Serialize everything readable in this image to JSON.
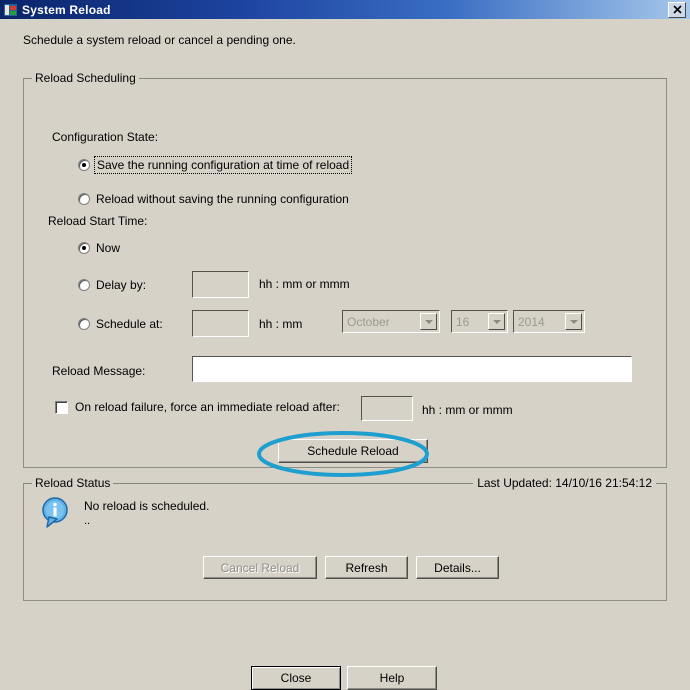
{
  "window": {
    "title": "System Reload",
    "icon": "app-icon",
    "close_label": "✕"
  },
  "intro": "Schedule a system reload or cancel a pending one.",
  "scheduling": {
    "legend": "Reload Scheduling",
    "config_state_label": "Configuration State:",
    "config_options": [
      {
        "label": "Save the running configuration at time of reload",
        "selected": true,
        "focused": true
      },
      {
        "label": "Reload without saving the running configuration",
        "selected": false,
        "focused": false
      }
    ],
    "start_time_label": "Reload Start Time:",
    "start_options": [
      {
        "label": "Now",
        "selected": true
      },
      {
        "label": "Delay by:",
        "selected": false
      },
      {
        "label": "Schedule at:",
        "selected": false
      }
    ],
    "delay_value": "",
    "delay_hint": "hh : mm or mmm",
    "schedule_time_value": "",
    "schedule_time_hint": "hh : mm",
    "month_value": "October",
    "day_value": "16",
    "year_value": "2014",
    "message_label": "Reload Message:",
    "message_value": "",
    "force_reload_label": "On reload failure, force an immediate reload after:",
    "force_reload_checked": false,
    "force_reload_value": "",
    "force_reload_hint": "hh : mm or mmm",
    "schedule_button": "Schedule Reload"
  },
  "status": {
    "legend": "Reload Status",
    "icon": "info-icon",
    "message": "No reload is scheduled.",
    "message_second_line": "..",
    "buttons": [
      {
        "label": "Cancel Reload",
        "disabled": true
      },
      {
        "label": "Refresh",
        "disabled": false
      },
      {
        "label": "Details...",
        "disabled": false
      }
    ],
    "last_updated": "Last Updated: 14/10/16 21:54:12"
  },
  "footer": {
    "close_label": "Close",
    "help_label": "Help"
  },
  "colors": {
    "annotation": "#1f9fd0",
    "titlebar_start": "#0a246a",
    "dialog_bg": "#d6d2c8",
    "info_blue": "#4ea6e0"
  }
}
